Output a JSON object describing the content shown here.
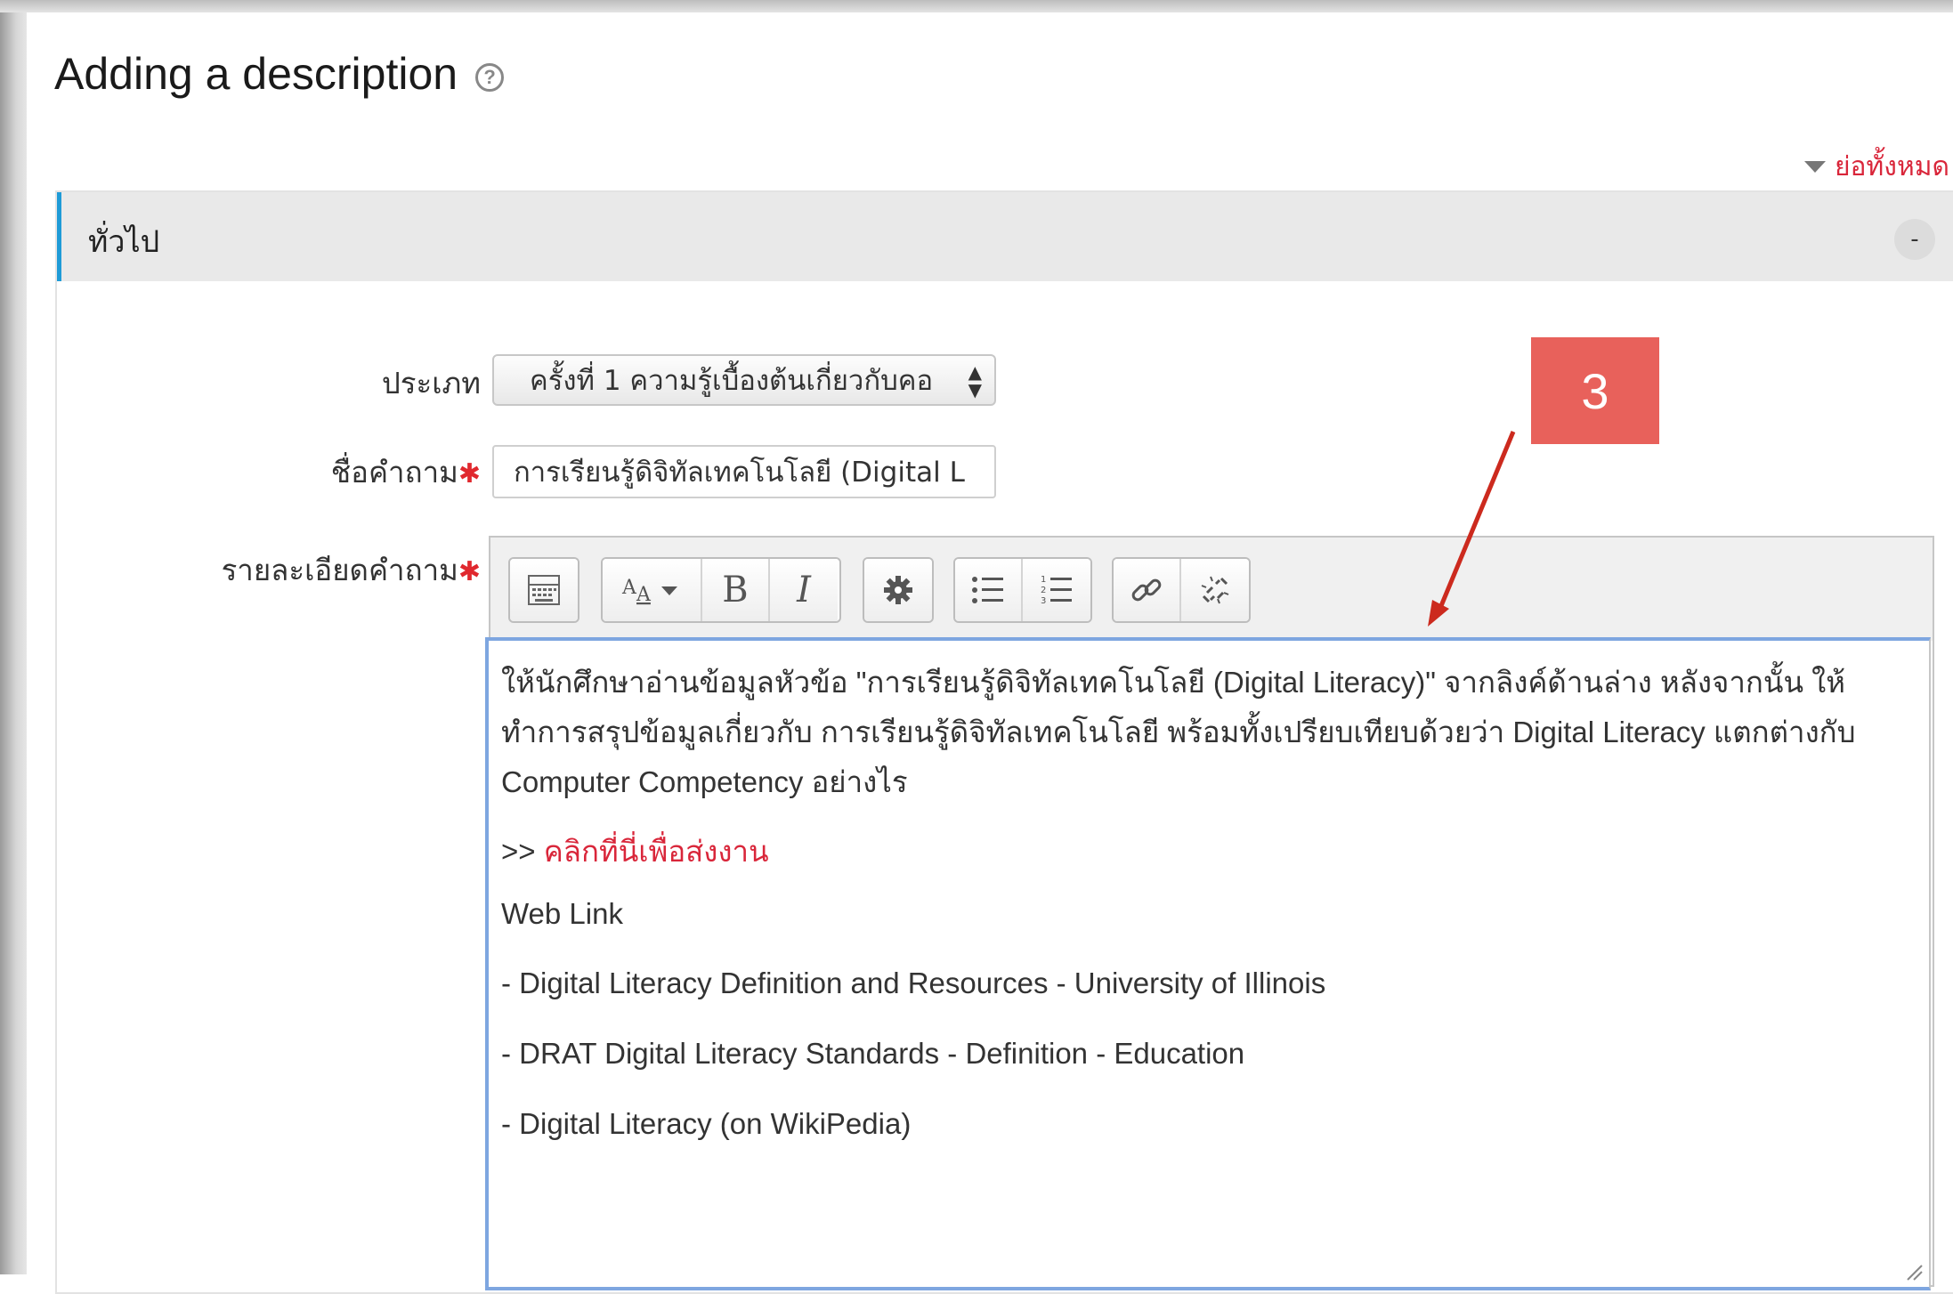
{
  "page": {
    "title": "Adding a description",
    "help_icon": "help-icon",
    "collapse_all_label": "ย่อทั้งหมด"
  },
  "section": {
    "legend": "ทั่วไป",
    "collapse_symbol": "-"
  },
  "form": {
    "type_label": "ประเภท",
    "type_value": "ครั้งที่ 1 ความรู้เบื้องต้นเกี่ยวกับคอ",
    "name_label": "ชื่อคำถาม",
    "name_value": "การเรียนรู้ดิจิทัลเทคโนโลยี (Digital L",
    "details_label": "รายละเอียดคำถาม",
    "required_marker": "✱"
  },
  "toolbar": {
    "groups": [
      [
        "toolbar-toggle-icon"
      ],
      [
        "font-size-icon",
        "bold-icon",
        "italic-icon"
      ],
      [
        "gear-icon"
      ],
      [
        "unordered-list-icon",
        "ordered-list-icon"
      ],
      [
        "link-icon",
        "unlink-icon"
      ]
    ]
  },
  "content": {
    "line1": "ให้นักศึกษาอ่านข้อมูลหัวข้อ \"การเรียนรู้ดิจิทัลเทคโนโลยี (Digital Literacy)\" จากลิงค์ด้านล่าง หลังจากนั้น ให้",
    "line2": "ทำการสรุปข้อมูลเกี่ยวกับ การเรียนรู้ดิจิทัลเทคโนโลยี พร้อมทั้งเปรียบเทียบด้วยว่า Digital Literacy แตกต่างกับ",
    "line3": "Computer Competency อย่างไร",
    "submit_prefix": ">> ",
    "submit_link": "คลิกที่นี่เพื่อส่งงาน",
    "web_link_heading": "Web Link",
    "links": [
      "- Digital Literacy Definition and Resources - University of Illinois",
      "- DRAT Digital Literacy Standards - Definition - Education",
      "- Digital Literacy (on WikiPedia)"
    ]
  },
  "annotation": {
    "number": "3",
    "color": "#e8615b",
    "arrow_color": "#cc2a1e"
  },
  "colors": {
    "accent_blue": "#1e9bd7",
    "required_red": "#e0282e",
    "link_red": "#d9263a",
    "focus_blue": "#7ea6e0"
  }
}
